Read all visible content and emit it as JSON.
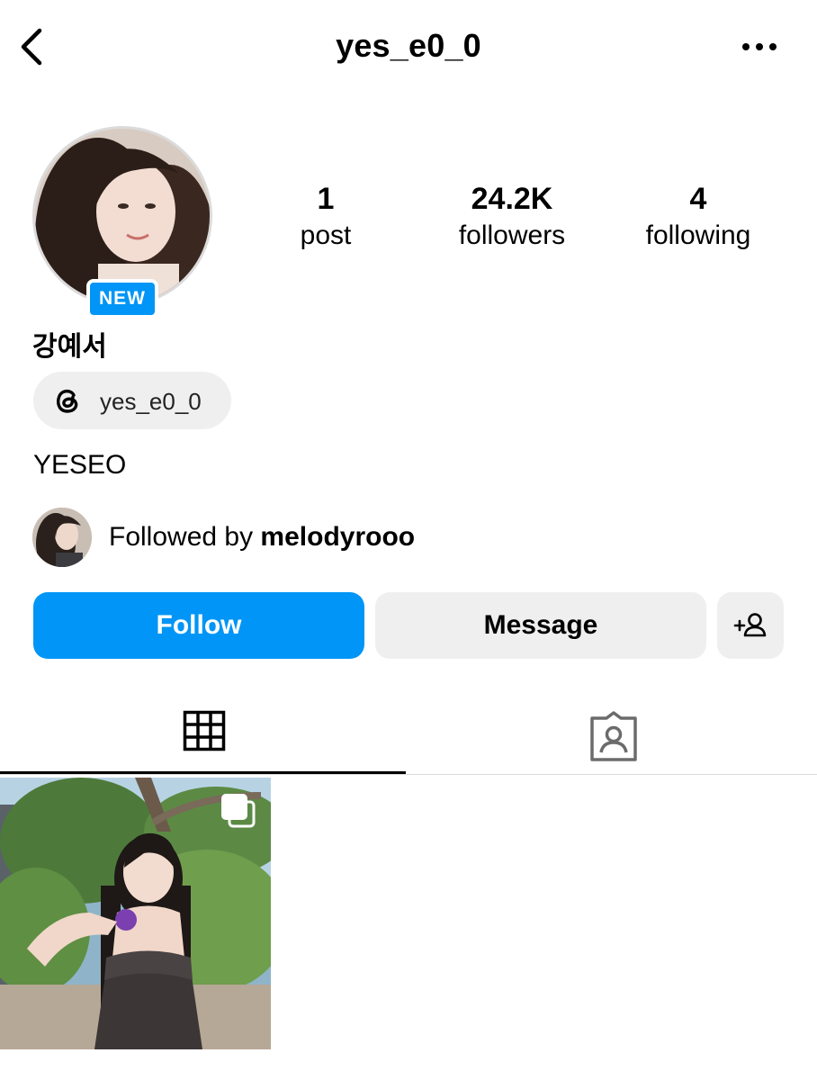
{
  "header": {
    "username": "yes_e0_0",
    "back_icon": "chevron-left-icon",
    "more_icon": "more-horizontal-icon"
  },
  "profile": {
    "badge": "NEW",
    "display_name": "강예서",
    "threads_handle": "yes_e0_0",
    "bio": "YESEO"
  },
  "stats": [
    {
      "value": "1",
      "label": "post"
    },
    {
      "value": "24.2K",
      "label": "followers"
    },
    {
      "value": "4",
      "label": "following"
    }
  ],
  "followed_by": {
    "prefix": "Followed by",
    "user": "melodyrooo"
  },
  "actions": {
    "follow_label": "Follow",
    "message_label": "Message",
    "add_icon": "add-person-icon"
  },
  "tabs": [
    {
      "name": "grid",
      "icon": "grid-icon",
      "active": true
    },
    {
      "name": "tagged",
      "icon": "tagged-person-icon",
      "active": false
    }
  ],
  "colors": {
    "accent": "#0095f6",
    "button_gray": "#efefef",
    "divider": "#dbdbdb"
  }
}
